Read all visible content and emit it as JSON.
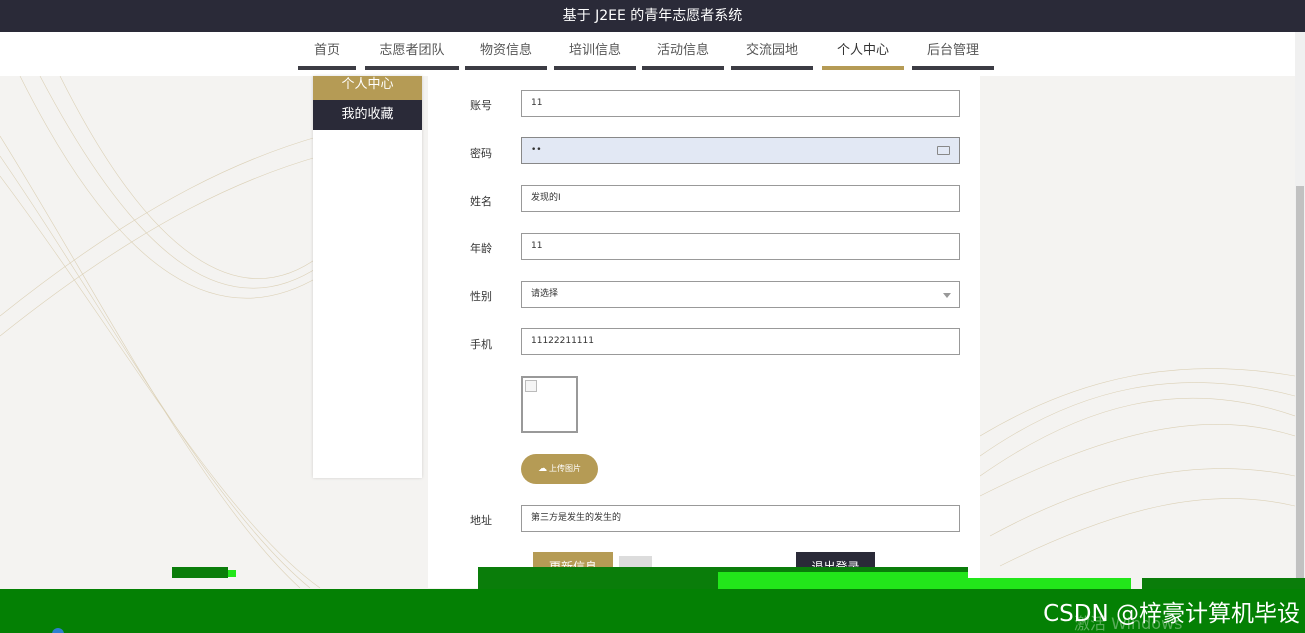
{
  "app": {
    "title": "基于 J2EE 的青年志愿者系统"
  },
  "nav": {
    "items": [
      {
        "label": "首页"
      },
      {
        "label": "志愿者团队"
      },
      {
        "label": "物资信息"
      },
      {
        "label": "培训信息"
      },
      {
        "label": "活动信息"
      },
      {
        "label": "交流园地"
      },
      {
        "label": "个人中心",
        "active": true
      },
      {
        "label": "后台管理"
      }
    ]
  },
  "sidebar": {
    "items": [
      {
        "label": "个人中心",
        "active": true
      },
      {
        "label": "我的收藏"
      }
    ]
  },
  "form": {
    "account": {
      "label": "账号",
      "value": "11"
    },
    "password": {
      "label": "密码",
      "value": "••"
    },
    "name": {
      "label": "姓名",
      "value": "发现的I"
    },
    "age": {
      "label": "年龄",
      "value": "11"
    },
    "gender": {
      "label": "性别",
      "value": "请选择"
    },
    "phone": {
      "label": "手机",
      "value": "11122211111"
    },
    "upload_label": "上传图片",
    "address": {
      "label": "地址",
      "value": "第三方是发生的发生的"
    },
    "update_button": "更新信息",
    "logout_button": "退出登录"
  },
  "overlay": {
    "watermark": "CSDN @梓豪计算机毕设",
    "activate_text": "激活 Windows"
  },
  "colors": {
    "accent": "#b59b55",
    "dark": "#2a2a38",
    "green_bar": "#048004"
  }
}
